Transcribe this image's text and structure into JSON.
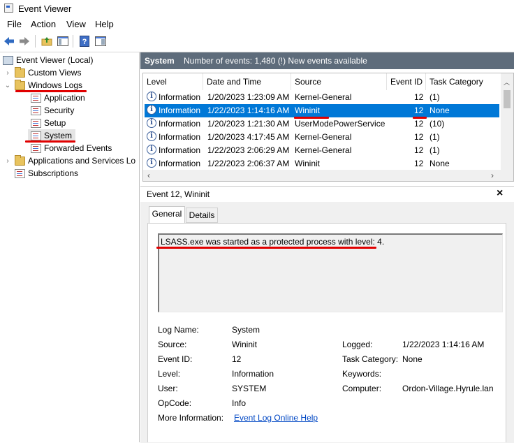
{
  "window": {
    "title": "Event Viewer"
  },
  "menu": [
    "File",
    "Action",
    "View",
    "Help"
  ],
  "toolbar": {
    "icons": [
      "back-arrow-icon",
      "forward-arrow-icon",
      "folder-up-icon",
      "show-hide-tree-icon",
      "help-icon",
      "properties-icon"
    ]
  },
  "tree": {
    "root": "Event Viewer (Local)",
    "custom_views": "Custom Views",
    "windows_logs": "Windows Logs",
    "application": "Application",
    "security": "Security",
    "setup": "Setup",
    "system": "System",
    "forwarded": "Forwarded Events",
    "apps_services": "Applications and Services Lo",
    "subscriptions": "Subscriptions"
  },
  "header": {
    "log_name": "System",
    "summary": "Number of events: 1,480 (!) New events available"
  },
  "columns": [
    "Level",
    "Date and Time",
    "Source",
    "Event ID",
    "Task Category"
  ],
  "rows": [
    {
      "level": "Information",
      "date": "1/20/2023 1:23:09 AM",
      "source": "Kernel-General",
      "id": "12",
      "task": "(1)"
    },
    {
      "level": "Information",
      "date": "1/22/2023 1:14:16 AM",
      "source": "Wininit",
      "id": "12",
      "task": "None"
    },
    {
      "level": "Information",
      "date": "1/20/2023 1:21:30 AM",
      "source": "UserModePowerService",
      "id": "12",
      "task": "(10)"
    },
    {
      "level": "Information",
      "date": "1/20/2023 4:17:45 AM",
      "source": "Kernel-General",
      "id": "12",
      "task": "(1)"
    },
    {
      "level": "Information",
      "date": "1/22/2023 2:06:29 AM",
      "source": "Kernel-General",
      "id": "12",
      "task": "(1)"
    },
    {
      "level": "Information",
      "date": "1/22/2023 2:06:37 AM",
      "source": "Wininit",
      "id": "12",
      "task": "None"
    }
  ],
  "detail": {
    "title": "Event 12, Wininit",
    "close": "×",
    "tabs": [
      "General",
      "Details"
    ],
    "message": "LSASS.exe was started as a protected process with level: 4.",
    "props": {
      "log_name_label": "Log Name:",
      "log_name": "System",
      "source_label": "Source:",
      "source": "Wininit",
      "event_id_label": "Event ID:",
      "event_id": "12",
      "level_label": "Level:",
      "level": "Information",
      "user_label": "User:",
      "user": "SYSTEM",
      "opcode_label": "OpCode:",
      "opcode": "Info",
      "more_info_label": "More Information:",
      "more_info_link": "Event Log Online Help",
      "logged_label": "Logged:",
      "logged": "1/22/2023 1:14:16 AM",
      "task_label": "Task Category:",
      "task": "None",
      "keywords_label": "Keywords:",
      "keywords": "",
      "computer_label": "Computer:",
      "computer": "Ordon-Village.Hyrule.lan"
    }
  },
  "colors": {
    "selection": "#0078d7",
    "header_bar": "#5e6c7b",
    "annotation": "#e00000"
  }
}
